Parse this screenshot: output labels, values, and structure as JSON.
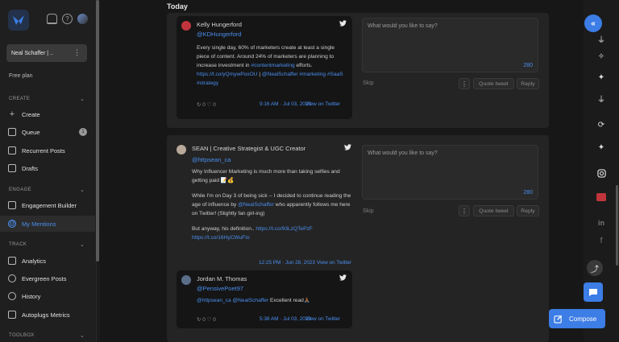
{
  "sidebar": {
    "profile_name": "Neal Schaffer | ..",
    "profile_menu": "⋮",
    "plan": "Free plan",
    "sections": {
      "create": "CREATE",
      "engage": "ENGAGE",
      "track": "TRACK",
      "toolbox": "TOOLBOX"
    },
    "items": {
      "create": "Create",
      "queue": "Queue",
      "queue_badge": "1",
      "recurrent_posts": "Recurrent Posts",
      "drafts": "Drafts",
      "engagement_builder": "Engagement Builder",
      "my_mentions": "My Mentions",
      "analytics": "Analytics",
      "evergreen_posts": "Evergreen Posts",
      "history": "History",
      "autoplugs_metrics": "Autoplugs Metrics"
    }
  },
  "main": {
    "heading": "Today",
    "mentions": [
      {
        "author": "Kelly Hungerford",
        "handle": "@KDHungerford",
        "text_a": "Every single day, 60% of marketers create at least a single piece of content. Around 24% of marketers are planning to increase investment in ",
        "hashtag_1": "#contentmarketing",
        "text_b": " efforts.",
        "url": "https://t.co/yQmywPoxOU",
        "text_c": " | ",
        "mention": "@NealSchaffer",
        "hashtag_2": " #marketing",
        "hashtags_3": "#SaaS #strategy",
        "stats": "↻ 0  ♡ 0",
        "time": "9:16 AM · Jul 03, 2023",
        "view": "View on Twitter",
        "reply_placeholder": "What would you like to say?",
        "char_count": "280",
        "skip": "Skip",
        "quote": "Quote tweet",
        "reply": "Reply"
      },
      {
        "author": "SEAN | Creative Strategist & UGC Creator",
        "handle": "@httpsean_ca",
        "p1": "Why Influencer Marketing is much more than taking selfies and getting paid 📝💰",
        "p2a": "While I'm on Day 3 of being sick -- I decided to continue reading the age of influence by ",
        "p2_mention": "@NealSchaffer",
        "p2b": " who apparently follows me here on Twitter! (Slightly fan girl-ing)",
        "p3a": "But anyway, his definition.. ",
        "p3_url1": "https://t.co/93LzQTePzF",
        "p3_url2": "https://t.co/16HyCWuFIo",
        "time": "12:25 PM · Jun 28, 2023",
        "view": "View on Twitter",
        "reply_placeholder": "What would you like to say?",
        "char_count": "280",
        "skip": "Skip",
        "quote": "Quote tweet",
        "reply": "Reply"
      },
      {
        "author": "Jordan M. Thomas",
        "handle": "@PensivePoet97",
        "mention_1": "@httpsean_ca",
        "mention_2": "@NealSchaffer",
        "text": " Excellent read🙏🏾",
        "stats": "↻ 0  ♡ 0",
        "time": "5:38 AM · Jul 03, 2023",
        "view": "View on Twitter"
      }
    ]
  },
  "rail": {
    "collapse": "«",
    "compose": "Compose",
    "up": "⤴"
  },
  "colors": {
    "accent": "#3c7de6",
    "link": "#4a8ff0",
    "background": "#171717"
  }
}
